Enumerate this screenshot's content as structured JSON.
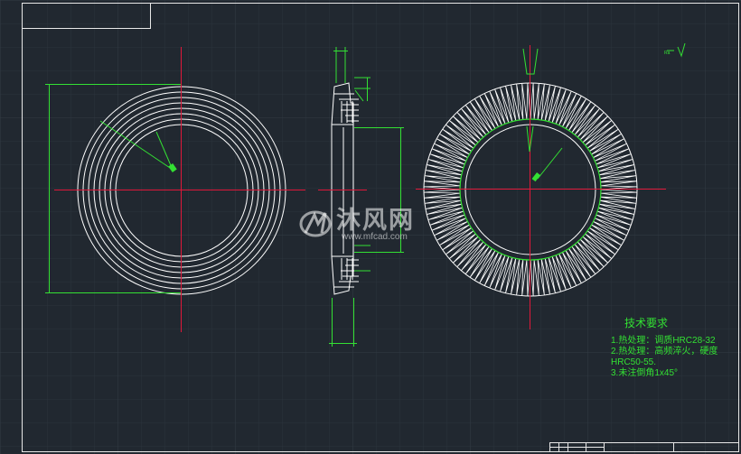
{
  "technical_notes": {
    "title": "技术要求",
    "lines": [
      "1.热处理：调质HRC28-32",
      "2.热处理：高频淬火，硬度",
      "HRC50-55.",
      "3.未注倒角1x45°"
    ]
  },
  "roughness_symbol": "Ra",
  "watermark": {
    "text_cn": "沐风网",
    "url": "www.mfcad.com"
  },
  "colors": {
    "background": "#212830",
    "grid": "#2c343d",
    "frame": "#e8e8e8",
    "geometry": "#ffffff",
    "center_line": "#e0183a",
    "dimension": "#33e033"
  }
}
